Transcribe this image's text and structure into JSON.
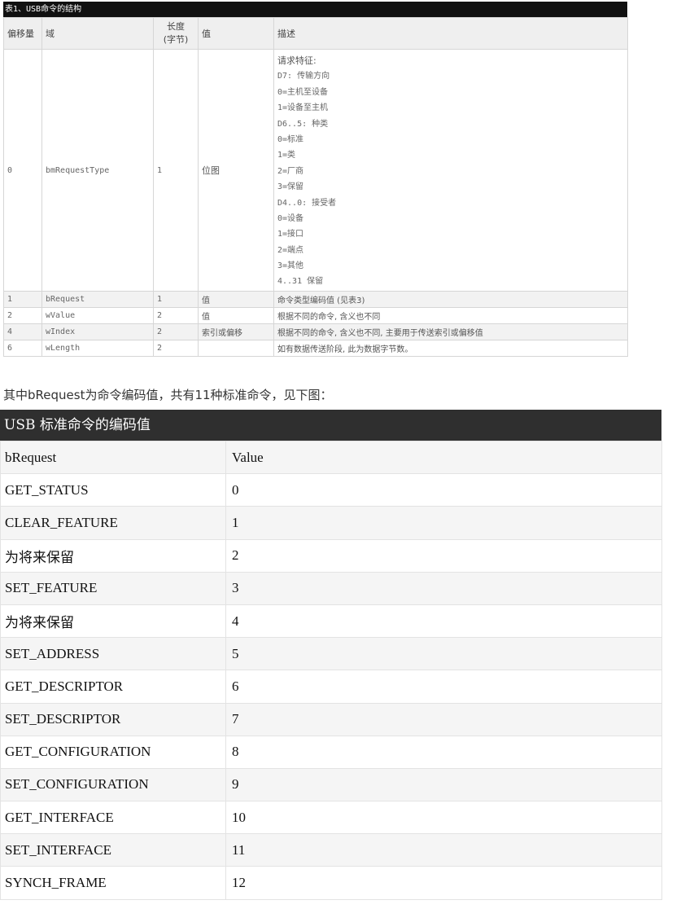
{
  "table1": {
    "caption": "表1、USB命令的结构",
    "headers": {
      "offset": "偏移量",
      "field": "域",
      "length_line1": "长度",
      "length_line2": "(字节)",
      "value": "值",
      "desc": "描述"
    },
    "row0": {
      "offset": "0",
      "field": "bmRequestType",
      "length": "1",
      "value": "位图",
      "desc_lines": [
        "请求特征:",
        "D7: 传输方向",
        "0=主机至设备",
        "1=设备至主机",
        "D6..5: 种类",
        "0=标准",
        "1=类",
        "2=厂商",
        "3=保留",
        "D4..0: 接受者",
        "0=设备",
        "1=接口",
        "2=端点",
        "3=其他",
        "4..31 保留"
      ]
    },
    "rows": [
      {
        "offset": "1",
        "field": "bRequest",
        "length": "1",
        "value": "值",
        "desc": "命令类型编码值 (见表3)"
      },
      {
        "offset": "2",
        "field": "wValue",
        "length": "2",
        "value": "值",
        "desc": "根据不同的命令, 含义也不同"
      },
      {
        "offset": "4",
        "field": "wIndex",
        "length": "2",
        "value": "索引或偏移",
        "desc": "根据不同的命令, 含义也不同, 主要用于传送索引或偏移值"
      },
      {
        "offset": "6",
        "field": "wLength",
        "length": "2",
        "value": "",
        "desc": "如有数据传送阶段, 此为数据字节数。"
      }
    ]
  },
  "paragraph": "其中bRequest为命令编码值，共有11种标准命令，见下图：",
  "table2": {
    "caption": "USB 标准命令的编码值",
    "rows": [
      {
        "name": "bRequest",
        "value": "Value"
      },
      {
        "name": "GET_STATUS",
        "value": "0"
      },
      {
        "name": "CLEAR_FEATURE",
        "value": "1"
      },
      {
        "name": "为将来保留",
        "value": "2"
      },
      {
        "name": "SET_FEATURE",
        "value": "3"
      },
      {
        "name": "为将来保留",
        "value": "4"
      },
      {
        "name": "SET_ADDRESS",
        "value": "5"
      },
      {
        "name": "GET_DESCRIPTOR",
        "value": "6"
      },
      {
        "name": "SET_DESCRIPTOR",
        "value": "7"
      },
      {
        "name": "GET_CONFIGURATION",
        "value": "8"
      },
      {
        "name": "SET_CONFIGURATION",
        "value": "9"
      },
      {
        "name": "GET_INTERFACE",
        "value": "10"
      },
      {
        "name": "SET_INTERFACE",
        "value": "11"
      },
      {
        "name": "SYNCH_FRAME",
        "value": "12"
      }
    ]
  }
}
